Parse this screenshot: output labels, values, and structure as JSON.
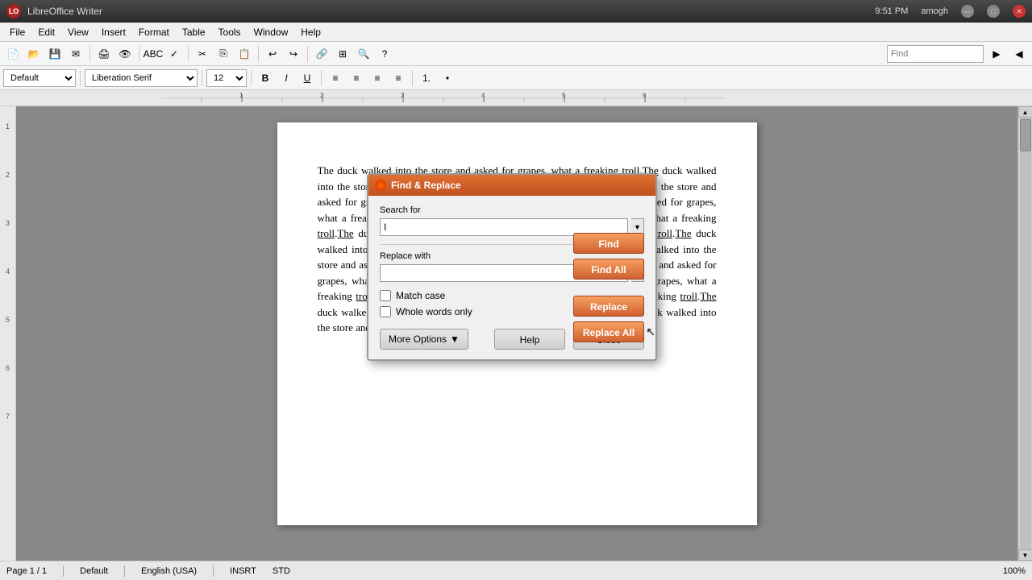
{
  "app": {
    "title": "LibreOffice Writer",
    "icon": "LO"
  },
  "titlebar": {
    "title": "LibreOffice Writer",
    "time": "9:51 PM",
    "user": "amogh"
  },
  "menubar": {
    "items": [
      "File",
      "Edit",
      "View",
      "Insert",
      "Format",
      "Table",
      "Tools",
      "Window",
      "Help"
    ]
  },
  "toolbar2": {
    "style_combo": "Default",
    "font_combo": "Liberation Serif",
    "size_combo": "12"
  },
  "statusbar": {
    "page_info": "Page 1 / 1",
    "style": "Default",
    "language": "English (USA)",
    "mode1": "INSRT",
    "mode2": "STD",
    "zoom": "100%"
  },
  "document": {
    "text": "The duck walked into the store and asked for grapes, what a freaking troll. The duck walked into the store and asked for grapes, what a freaking troll. The duck walked into the store and asked for grapes, what a freaking troll. The duck walked into the store and asked for grapes, what a freaking troll. The duck walked into the store and asked for grapes, what a freaking troll. The duck walked into the store and asked for grapes, what a freaking troll. The duck walked into the store and asked for grapes, what a freaking troll. The duck walked into the store and asked for grapes, what a freaking troll. The duck walked into the store and asked for grapes, what a freaking troll. The duck walked into the store and asked for grapes, what a freaking troll. The duck walked into the store and asked for grapes, what a freaking troll. The duck walked into the store and asked for grapes, what a freaking troll. The duck walked into the store and asked for grapes, what a freaking troll."
  },
  "find_replace": {
    "title": "Find & Replace",
    "search_label": "Search for",
    "search_value": "I",
    "replace_label": "Replace with",
    "replace_value": "",
    "find_btn": "Find",
    "find_all_btn": "Find All",
    "replace_btn": "Replace",
    "replace_all_btn": "Replace All",
    "match_case_label": "Match case",
    "whole_words_label": "Whole words only",
    "more_options_label": "More Options",
    "help_label": "Help",
    "close_label": "Close"
  }
}
